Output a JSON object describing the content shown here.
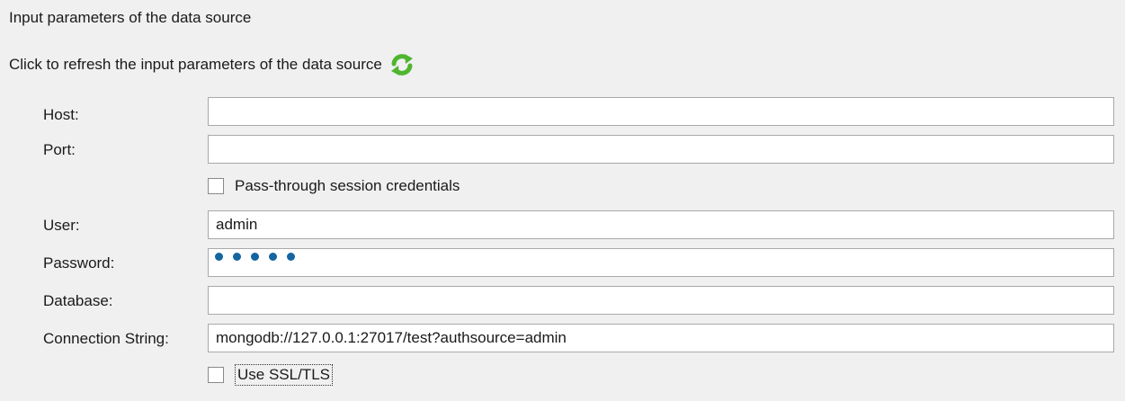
{
  "heading": "Input parameters of the data source",
  "refresh": {
    "label": "Click to refresh the input parameters of the data source",
    "icon": "refresh-icon"
  },
  "fields": {
    "host": {
      "label": "Host:",
      "value": ""
    },
    "port": {
      "label": "Port:",
      "value": ""
    },
    "user": {
      "label": "User:",
      "value": "admin"
    },
    "password": {
      "label": "Password:",
      "value": "•••••"
    },
    "database": {
      "label": "Database:",
      "value": ""
    },
    "connection_string": {
      "label": "Connection String:",
      "value": "mongodb://127.0.0.1:27017/test?authsource=admin"
    }
  },
  "checkboxes": {
    "pass_through": {
      "label": "Pass-through session credentials",
      "checked": false
    },
    "ssl": {
      "label": "Use SSL/TLS",
      "checked": false
    }
  },
  "colors": {
    "background": "#f0f0f0",
    "password_dot": "#1565a0",
    "refresh_icon": "#4fb52e"
  }
}
